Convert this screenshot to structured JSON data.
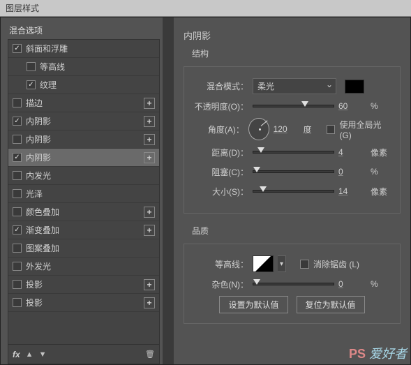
{
  "window": {
    "title": "图层样式"
  },
  "left": {
    "header": "混合选项",
    "items": [
      {
        "label": "斜面和浮雕",
        "checked": true,
        "hasPlus": false,
        "sub": false,
        "selected": false
      },
      {
        "label": "等高线",
        "checked": false,
        "hasPlus": false,
        "sub": true,
        "selected": false
      },
      {
        "label": "纹理",
        "checked": true,
        "hasPlus": false,
        "sub": true,
        "selected": false
      },
      {
        "label": "描边",
        "checked": false,
        "hasPlus": true,
        "sub": false,
        "selected": false
      },
      {
        "label": "内阴影",
        "checked": true,
        "hasPlus": true,
        "sub": false,
        "selected": false
      },
      {
        "label": "内阴影",
        "checked": false,
        "hasPlus": true,
        "sub": false,
        "selected": false
      },
      {
        "label": "内阴影",
        "checked": true,
        "hasPlus": true,
        "sub": false,
        "selected": true
      },
      {
        "label": "内发光",
        "checked": false,
        "hasPlus": false,
        "sub": false,
        "selected": false
      },
      {
        "label": "光泽",
        "checked": false,
        "hasPlus": false,
        "sub": false,
        "selected": false
      },
      {
        "label": "颜色叠加",
        "checked": false,
        "hasPlus": true,
        "sub": false,
        "selected": false
      },
      {
        "label": "渐变叠加",
        "checked": true,
        "hasPlus": true,
        "sub": false,
        "selected": false
      },
      {
        "label": "图案叠加",
        "checked": false,
        "hasPlus": false,
        "sub": false,
        "selected": false
      },
      {
        "label": "外发光",
        "checked": false,
        "hasPlus": false,
        "sub": false,
        "selected": false
      },
      {
        "label": "投影",
        "checked": false,
        "hasPlus": true,
        "sub": false,
        "selected": false
      },
      {
        "label": "投影",
        "checked": false,
        "hasPlus": true,
        "sub": false,
        "selected": false
      }
    ],
    "fx": "fx"
  },
  "right": {
    "title": "内阴影",
    "structure": {
      "title": "结构",
      "blend": {
        "label": "混合模式：",
        "value": "柔光"
      },
      "opacity": {
        "label": "不透明度(O)：",
        "value": "60",
        "pct": 60,
        "unit": "%"
      },
      "angle": {
        "label": "角度(A)：",
        "value": "120",
        "unit": "度",
        "global": "使用全局光 (G)"
      },
      "distance": {
        "label": "距离(D)：",
        "value": "4",
        "pct": 5,
        "unit": "像素"
      },
      "choke": {
        "label": "阻塞(C)：",
        "value": "0",
        "pct": 0,
        "unit": "%"
      },
      "size": {
        "label": "大小(S)：",
        "value": "14",
        "pct": 8,
        "unit": "像素"
      }
    },
    "quality": {
      "title": "品质",
      "contour": {
        "label": "等高线：",
        "antialias": "消除锯齿 (L)"
      },
      "noise": {
        "label": "杂色(N)：",
        "value": "0",
        "pct": 0,
        "unit": "%"
      }
    },
    "buttons": {
      "default": "设置为默认值",
      "reset": "复位为默认值"
    }
  },
  "watermark": {
    "a": "PS",
    "b": "爱好者"
  }
}
